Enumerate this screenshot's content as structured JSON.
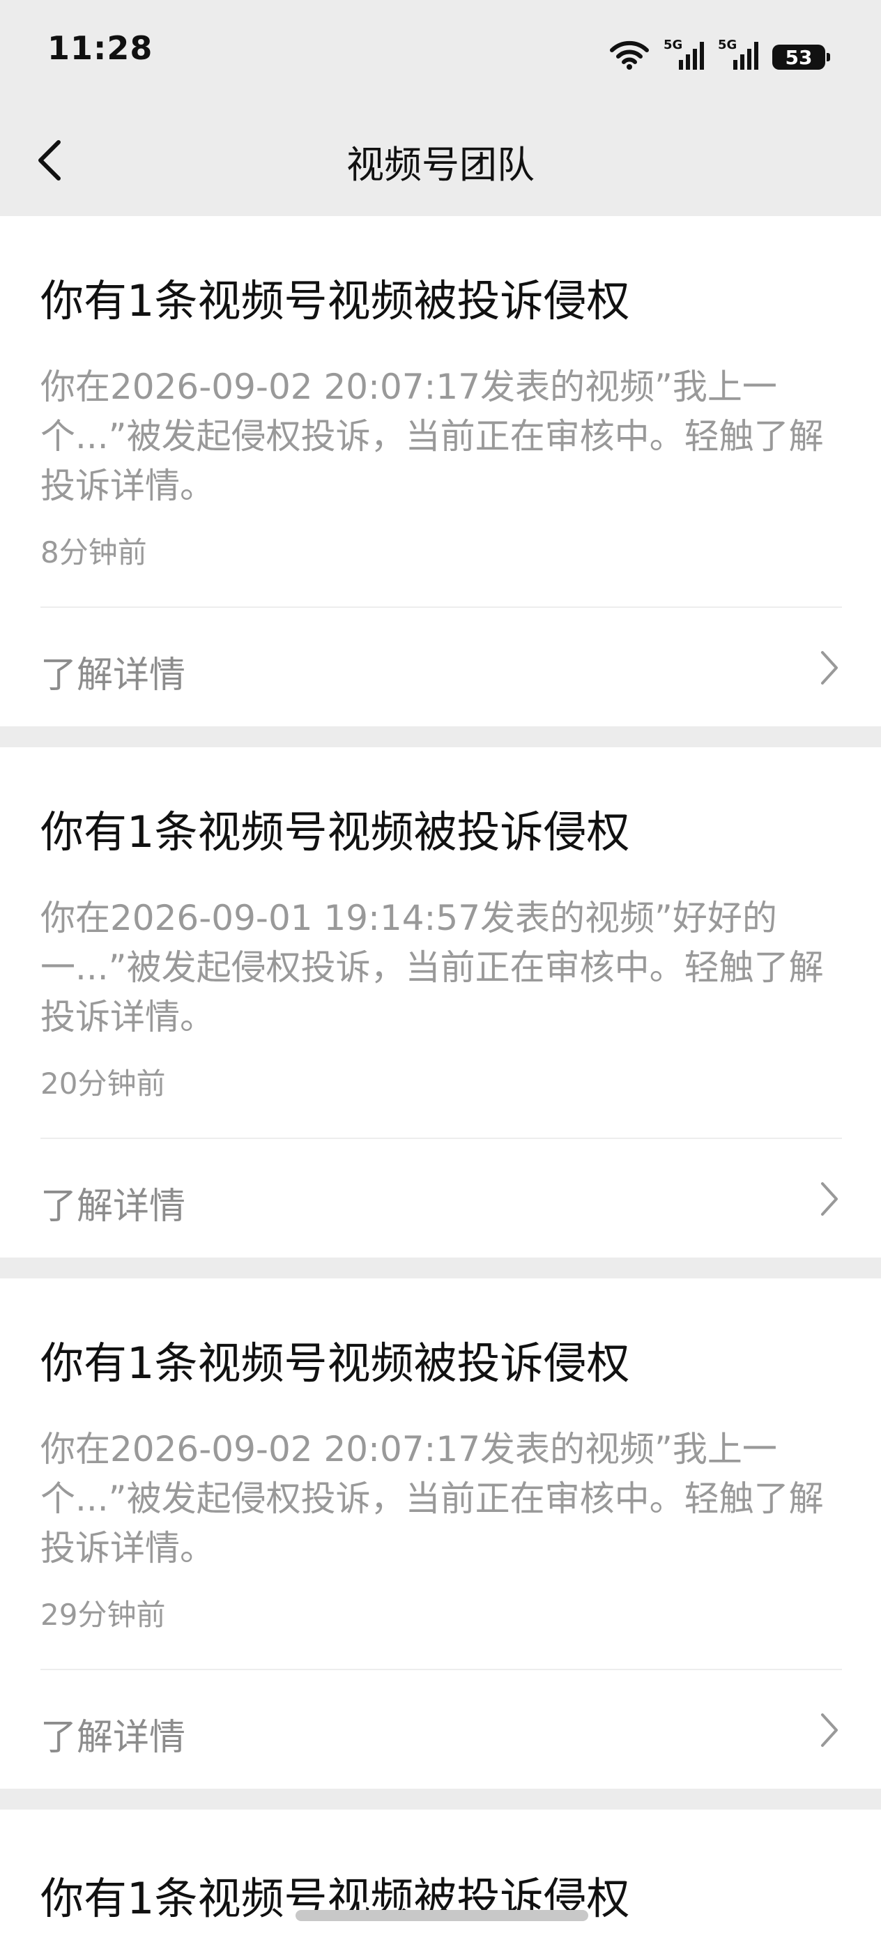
{
  "status_bar": {
    "time": "11:28",
    "signal1_tag": "5G",
    "signal2_tag": "5G",
    "battery": "53",
    "icons": [
      "wifi-icon",
      "cellular-signal-icon",
      "cellular-signal-icon",
      "battery-icon"
    ]
  },
  "header": {
    "title": "视频号团队",
    "back_icon": "back-chevron-icon"
  },
  "messages": [
    {
      "title": "你有1条视频号视频被投诉侵权",
      "description": "你在2026-09-02 20:07:17发表的视频”我上一个...”被发起侵权投诉，当前正在审核中。轻触了解投诉详情。",
      "time": "8分钟前",
      "link_label": "了解详情"
    },
    {
      "title": "你有1条视频号视频被投诉侵权",
      "description": "你在2026-09-01 19:14:57发表的视频”好好的一...”被发起侵权投诉，当前正在审核中。轻触了解投诉详情。",
      "time": "20分钟前",
      "link_label": "了解详情"
    },
    {
      "title": "你有1条视频号视频被投诉侵权",
      "description": "你在2026-09-02 20:07:17发表的视频”我上一个...”被发起侵权投诉，当前正在审核中。轻触了解投诉详情。",
      "time": "29分钟前",
      "link_label": "了解详情"
    },
    {
      "title": "你有1条视频号视频被投诉侵权"
    }
  ],
  "colors": {
    "background": "#ececec",
    "card": "#ffffff",
    "title_text": "#111111",
    "secondary_text": "#999999"
  }
}
